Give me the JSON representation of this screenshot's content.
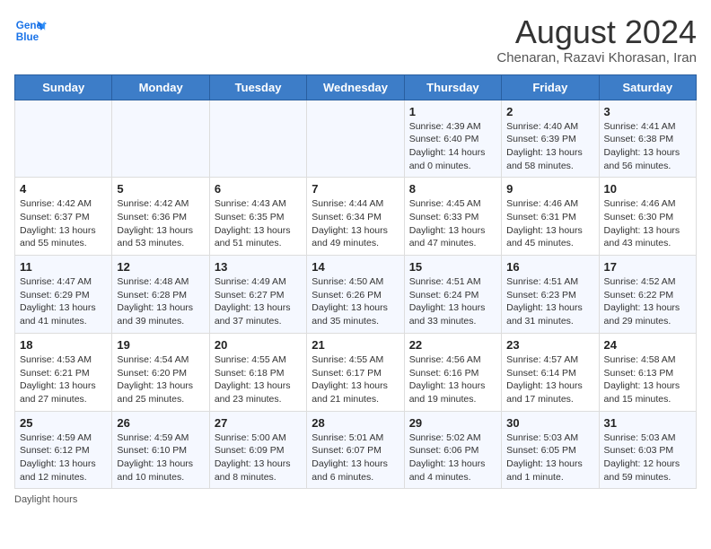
{
  "logo": {
    "line1": "General",
    "line2": "Blue"
  },
  "title": "August 2024",
  "subtitle": "Chenaran, Razavi Khorasan, Iran",
  "days_of_week": [
    "Sunday",
    "Monday",
    "Tuesday",
    "Wednesday",
    "Thursday",
    "Friday",
    "Saturday"
  ],
  "footer": "Daylight hours",
  "weeks": [
    [
      {
        "day": "",
        "info": ""
      },
      {
        "day": "",
        "info": ""
      },
      {
        "day": "",
        "info": ""
      },
      {
        "day": "",
        "info": ""
      },
      {
        "day": "1",
        "info": "Sunrise: 4:39 AM\nSunset: 6:40 PM\nDaylight: 14 hours\nand 0 minutes."
      },
      {
        "day": "2",
        "info": "Sunrise: 4:40 AM\nSunset: 6:39 PM\nDaylight: 13 hours\nand 58 minutes."
      },
      {
        "day": "3",
        "info": "Sunrise: 4:41 AM\nSunset: 6:38 PM\nDaylight: 13 hours\nand 56 minutes."
      }
    ],
    [
      {
        "day": "4",
        "info": "Sunrise: 4:42 AM\nSunset: 6:37 PM\nDaylight: 13 hours\nand 55 minutes."
      },
      {
        "day": "5",
        "info": "Sunrise: 4:42 AM\nSunset: 6:36 PM\nDaylight: 13 hours\nand 53 minutes."
      },
      {
        "day": "6",
        "info": "Sunrise: 4:43 AM\nSunset: 6:35 PM\nDaylight: 13 hours\nand 51 minutes."
      },
      {
        "day": "7",
        "info": "Sunrise: 4:44 AM\nSunset: 6:34 PM\nDaylight: 13 hours\nand 49 minutes."
      },
      {
        "day": "8",
        "info": "Sunrise: 4:45 AM\nSunset: 6:33 PM\nDaylight: 13 hours\nand 47 minutes."
      },
      {
        "day": "9",
        "info": "Sunrise: 4:46 AM\nSunset: 6:31 PM\nDaylight: 13 hours\nand 45 minutes."
      },
      {
        "day": "10",
        "info": "Sunrise: 4:46 AM\nSunset: 6:30 PM\nDaylight: 13 hours\nand 43 minutes."
      }
    ],
    [
      {
        "day": "11",
        "info": "Sunrise: 4:47 AM\nSunset: 6:29 PM\nDaylight: 13 hours\nand 41 minutes."
      },
      {
        "day": "12",
        "info": "Sunrise: 4:48 AM\nSunset: 6:28 PM\nDaylight: 13 hours\nand 39 minutes."
      },
      {
        "day": "13",
        "info": "Sunrise: 4:49 AM\nSunset: 6:27 PM\nDaylight: 13 hours\nand 37 minutes."
      },
      {
        "day": "14",
        "info": "Sunrise: 4:50 AM\nSunset: 6:26 PM\nDaylight: 13 hours\nand 35 minutes."
      },
      {
        "day": "15",
        "info": "Sunrise: 4:51 AM\nSunset: 6:24 PM\nDaylight: 13 hours\nand 33 minutes."
      },
      {
        "day": "16",
        "info": "Sunrise: 4:51 AM\nSunset: 6:23 PM\nDaylight: 13 hours\nand 31 minutes."
      },
      {
        "day": "17",
        "info": "Sunrise: 4:52 AM\nSunset: 6:22 PM\nDaylight: 13 hours\nand 29 minutes."
      }
    ],
    [
      {
        "day": "18",
        "info": "Sunrise: 4:53 AM\nSunset: 6:21 PM\nDaylight: 13 hours\nand 27 minutes."
      },
      {
        "day": "19",
        "info": "Sunrise: 4:54 AM\nSunset: 6:20 PM\nDaylight: 13 hours\nand 25 minutes."
      },
      {
        "day": "20",
        "info": "Sunrise: 4:55 AM\nSunset: 6:18 PM\nDaylight: 13 hours\nand 23 minutes."
      },
      {
        "day": "21",
        "info": "Sunrise: 4:55 AM\nSunset: 6:17 PM\nDaylight: 13 hours\nand 21 minutes."
      },
      {
        "day": "22",
        "info": "Sunrise: 4:56 AM\nSunset: 6:16 PM\nDaylight: 13 hours\nand 19 minutes."
      },
      {
        "day": "23",
        "info": "Sunrise: 4:57 AM\nSunset: 6:14 PM\nDaylight: 13 hours\nand 17 minutes."
      },
      {
        "day": "24",
        "info": "Sunrise: 4:58 AM\nSunset: 6:13 PM\nDaylight: 13 hours\nand 15 minutes."
      }
    ],
    [
      {
        "day": "25",
        "info": "Sunrise: 4:59 AM\nSunset: 6:12 PM\nDaylight: 13 hours\nand 12 minutes."
      },
      {
        "day": "26",
        "info": "Sunrise: 4:59 AM\nSunset: 6:10 PM\nDaylight: 13 hours\nand 10 minutes."
      },
      {
        "day": "27",
        "info": "Sunrise: 5:00 AM\nSunset: 6:09 PM\nDaylight: 13 hours\nand 8 minutes."
      },
      {
        "day": "28",
        "info": "Sunrise: 5:01 AM\nSunset: 6:07 PM\nDaylight: 13 hours\nand 6 minutes."
      },
      {
        "day": "29",
        "info": "Sunrise: 5:02 AM\nSunset: 6:06 PM\nDaylight: 13 hours\nand 4 minutes."
      },
      {
        "day": "30",
        "info": "Sunrise: 5:03 AM\nSunset: 6:05 PM\nDaylight: 13 hours\nand 1 minute."
      },
      {
        "day": "31",
        "info": "Sunrise: 5:03 AM\nSunset: 6:03 PM\nDaylight: 12 hours\nand 59 minutes."
      }
    ]
  ]
}
